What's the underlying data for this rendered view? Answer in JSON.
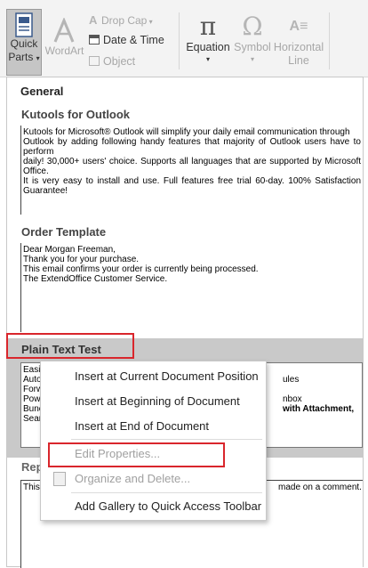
{
  "ribbon": {
    "quick_parts": {
      "line1": "Quick",
      "line2": "Parts"
    },
    "wordart": "WordArt",
    "drop_cap": "Drop Cap",
    "date_time": "Date & Time",
    "object": "Object",
    "equation": "Equation",
    "symbol": "Symbol",
    "horizontal_line": {
      "line1": "Horizontal",
      "line2": "Line"
    },
    "pi_glyph": "π",
    "omega_glyph": "Ω"
  },
  "gallery": {
    "title": "General",
    "sections": [
      {
        "header": "Kutools for Outlook",
        "lines": [
          "Kutools for Microsoft® Outlook will simplify your daily email communication through",
          "Outlook by adding following handy features that majority of Outlook users have to perform",
          "daily! 30,000+ users' choice. Supports all languages that are supported by Microsoft Office.",
          "It is very easy to install and use. Full features free trial 60-day. 100% Satisfaction Guarantee!"
        ]
      },
      {
        "header": "Order Template",
        "lines": [
          "Dear Morgan Freeman,",
          "Thank you for your purchase.",
          "This email confirms your order is currently being processed.",
          "The ExtendOffice Customer Service."
        ]
      },
      {
        "header": "Plain Text Test",
        "visible_left": [
          "Easily",
          "Autor",
          "Forwa",
          "Powe",
          "Bunch",
          "Searc"
        ],
        "visible_right": [
          "ules",
          "",
          "nbox",
          "with Attachment,"
        ]
      },
      {
        "header": "Rep",
        "left_text": "This",
        "right_text": "made on a comment."
      }
    ]
  },
  "context_menu": {
    "items": [
      {
        "label": "Insert at Current Document Position",
        "enabled": true
      },
      {
        "label": "Insert at Beginning of Document",
        "enabled": true
      },
      {
        "label": "Insert at End of Document",
        "enabled": true
      },
      {
        "label": "Edit Properties...",
        "enabled": false
      },
      {
        "label": "Organize and Delete...",
        "enabled": false
      },
      {
        "label": "Add Gallery to Quick Access Toolbar",
        "enabled": true
      }
    ]
  },
  "colors": {
    "highlight_red": "#d9262c",
    "selected_row": "#c9c9c9",
    "ribbon_bg": "#f3f3f3"
  }
}
